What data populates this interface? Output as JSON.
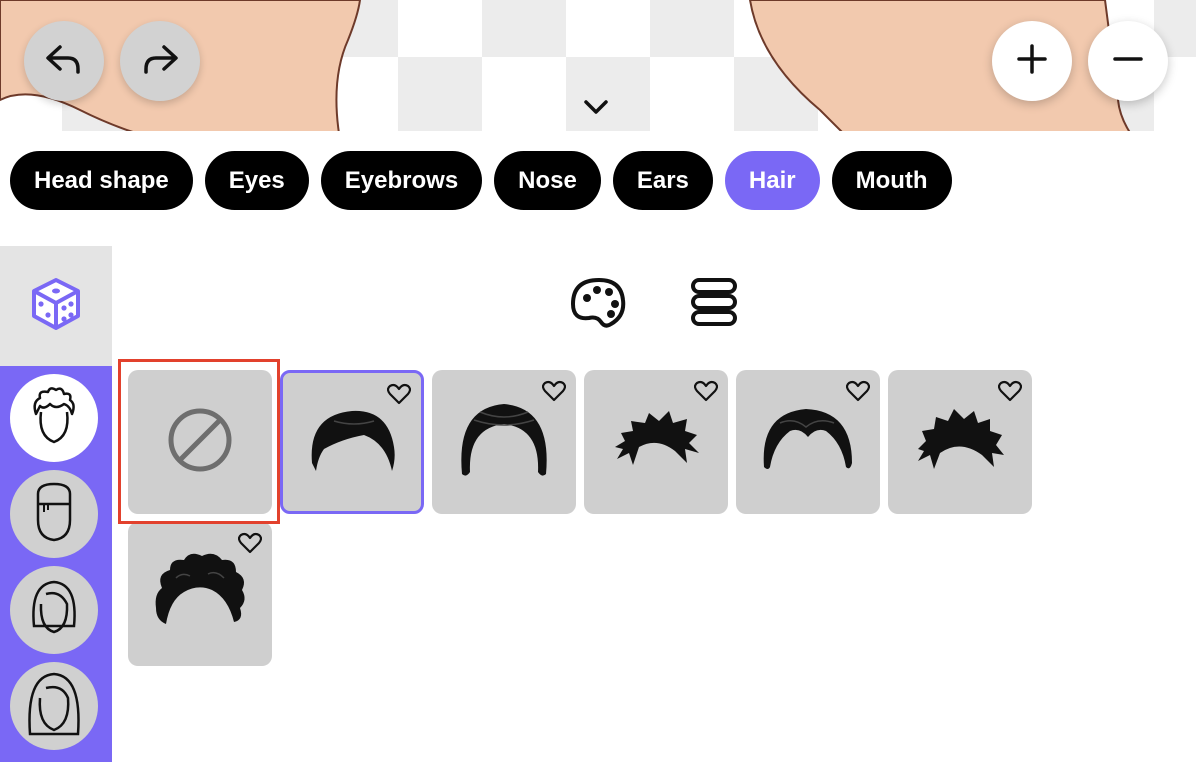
{
  "toolbar": {
    "undo_icon": "undo-arrow-icon",
    "redo_icon": "redo-arrow-icon",
    "zoom_in_icon": "plus-icon",
    "zoom_out_icon": "minus-icon",
    "collapse_icon": "chevron-down-icon"
  },
  "tabs": [
    {
      "label": "Head shape",
      "active": false
    },
    {
      "label": "Eyes",
      "active": false
    },
    {
      "label": "Eyebrows",
      "active": false
    },
    {
      "label": "Nose",
      "active": false
    },
    {
      "label": "Ears",
      "active": false
    },
    {
      "label": "Hair",
      "active": true
    },
    {
      "label": "Mouth",
      "active": false
    }
  ],
  "sidebar": {
    "randomize_icon": "dice-icon",
    "items": [
      {
        "icon": "short-spiky-hair-head-icon",
        "active": true
      },
      {
        "icon": "bangs-hair-head-icon",
        "active": false
      },
      {
        "icon": "bob-hair-head-icon",
        "active": false
      },
      {
        "icon": "long-hair-head-icon",
        "active": false
      }
    ]
  },
  "tools": {
    "color_icon": "palette-icon",
    "layers_icon": "layers-icon"
  },
  "styles": [
    {
      "icon": "none-icon",
      "selected": false,
      "favorite": false
    },
    {
      "icon": "hair-style-1",
      "selected": true,
      "favorite": false
    },
    {
      "icon": "hair-style-2",
      "selected": false,
      "favorite": false
    },
    {
      "icon": "hair-style-3",
      "selected": false,
      "favorite": false
    },
    {
      "icon": "hair-style-4",
      "selected": false,
      "favorite": false
    },
    {
      "icon": "hair-style-5",
      "selected": false,
      "favorite": false
    },
    {
      "icon": "hair-style-6",
      "selected": false,
      "favorite": false
    }
  ],
  "colors": {
    "accent": "#7a68f5",
    "tab_bg": "#000000",
    "tile_bg": "#cfcfcf",
    "highlight_outline": "#e2412d",
    "skin": "#f2c9ae"
  }
}
